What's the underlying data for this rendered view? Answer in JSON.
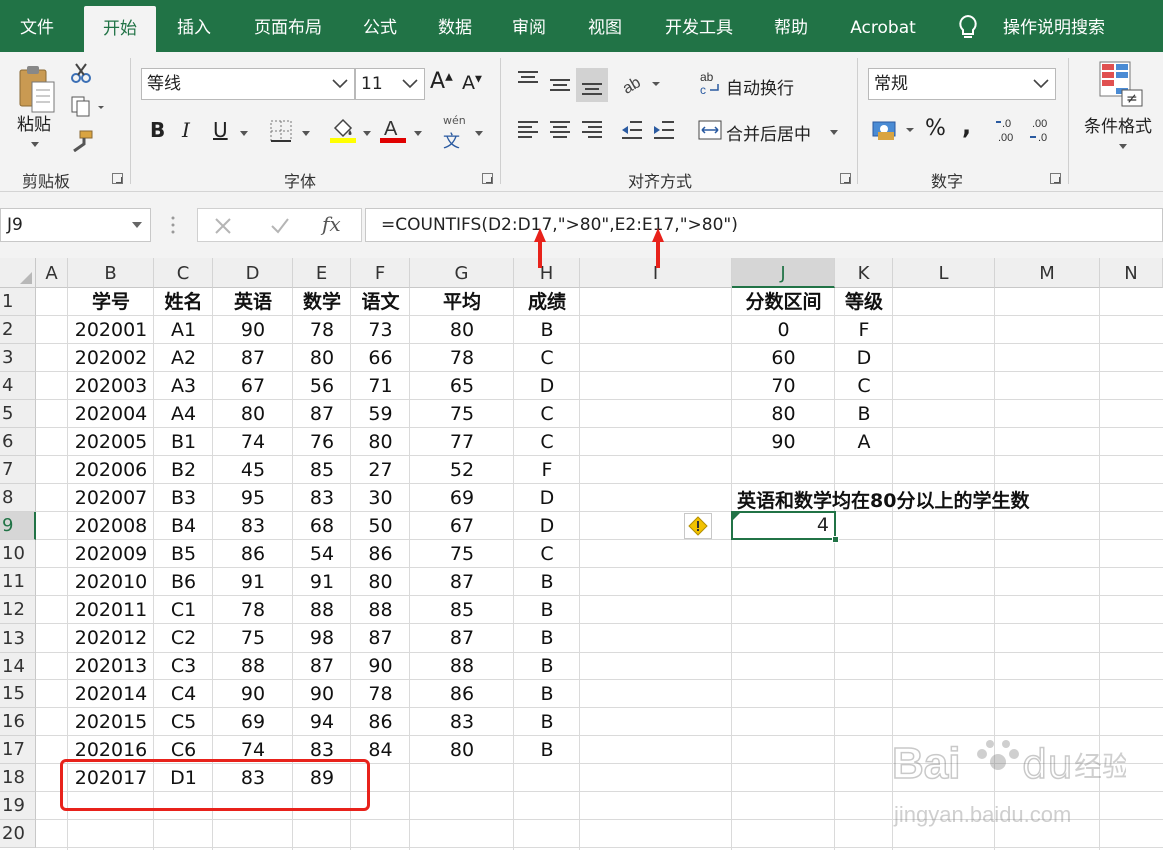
{
  "tabs": [
    "文件",
    "开始",
    "插入",
    "页面布局",
    "公式",
    "数据",
    "审阅",
    "视图",
    "开发工具",
    "帮助",
    "Acrobat",
    "操作说明搜索"
  ],
  "ribbon": {
    "clipboard": {
      "paste_label": "粘贴",
      "group_label": "剪贴板"
    },
    "font": {
      "font_name": "等线",
      "font_size": "11",
      "bold": "B",
      "italic": "I",
      "underline": "U",
      "phonetic": "wén",
      "group_label": "字体"
    },
    "alignment": {
      "wrap_text": "自动换行",
      "merge_center": "合并后居中",
      "group_label": "对齐方式"
    },
    "number": {
      "format": "常规",
      "percent": "%",
      "comma": ",",
      "group_label": "数字"
    },
    "styles": {
      "conditional_format": "条件格式"
    }
  },
  "formula_bar": {
    "name_box": "J9",
    "fx_label": "fx",
    "formula": "=COUNTIFS(D2:D17,\">80\",E2:E17,\">80\")"
  },
  "columns": [
    "A",
    "B",
    "C",
    "D",
    "E",
    "F",
    "G",
    "H",
    "I",
    "J",
    "K",
    "L",
    "M",
    "N"
  ],
  "rows": [
    "1",
    "2",
    "3",
    "4",
    "5",
    "6",
    "7",
    "8",
    "9",
    "10",
    "11",
    "12",
    "13",
    "14",
    "15",
    "16",
    "17",
    "18",
    "19",
    "20"
  ],
  "main_table": {
    "headers": [
      "学号",
      "姓名",
      "英语",
      "数学",
      "语文",
      "平均",
      "成绩"
    ],
    "rows": [
      [
        "202001",
        "A1",
        "90",
        "78",
        "73",
        "80",
        "B"
      ],
      [
        "202002",
        "A2",
        "87",
        "80",
        "66",
        "78",
        "C"
      ],
      [
        "202003",
        "A3",
        "67",
        "56",
        "71",
        "65",
        "D"
      ],
      [
        "202004",
        "A4",
        "80",
        "87",
        "59",
        "75",
        "C"
      ],
      [
        "202005",
        "B1",
        "74",
        "76",
        "80",
        "77",
        "C"
      ],
      [
        "202006",
        "B2",
        "45",
        "85",
        "27",
        "52",
        "F"
      ],
      [
        "202007",
        "B3",
        "95",
        "83",
        "30",
        "69",
        "D"
      ],
      [
        "202008",
        "B4",
        "83",
        "68",
        "50",
        "67",
        "D"
      ],
      [
        "202009",
        "B5",
        "86",
        "54",
        "86",
        "75",
        "C"
      ],
      [
        "202010",
        "B6",
        "91",
        "91",
        "80",
        "87",
        "B"
      ],
      [
        "202011",
        "C1",
        "78",
        "88",
        "88",
        "85",
        "B"
      ],
      [
        "202012",
        "C2",
        "75",
        "98",
        "87",
        "87",
        "B"
      ],
      [
        "202013",
        "C3",
        "88",
        "87",
        "90",
        "88",
        "B"
      ],
      [
        "202014",
        "C4",
        "90",
        "90",
        "78",
        "86",
        "B"
      ],
      [
        "202015",
        "C5",
        "69",
        "94",
        "86",
        "83",
        "B"
      ],
      [
        "202016",
        "C6",
        "74",
        "83",
        "84",
        "80",
        "B"
      ],
      [
        "202017",
        "D1",
        "83",
        "89",
        "",
        "",
        ""
      ]
    ]
  },
  "grade_table": {
    "headers": [
      "分数区间",
      "等级"
    ],
    "rows": [
      [
        "0",
        "F"
      ],
      [
        "60",
        "D"
      ],
      [
        "70",
        "C"
      ],
      [
        "80",
        "B"
      ],
      [
        "90",
        "A"
      ]
    ]
  },
  "question": "英语和数学均在80分以上的学生数",
  "result": "4",
  "watermark": {
    "brand": "Baidu经验",
    "url": "jingyan.baidu.com"
  },
  "colors": {
    "excel_green": "#217346",
    "annotation_red": "#e8221b",
    "selection_green": "#217346"
  }
}
